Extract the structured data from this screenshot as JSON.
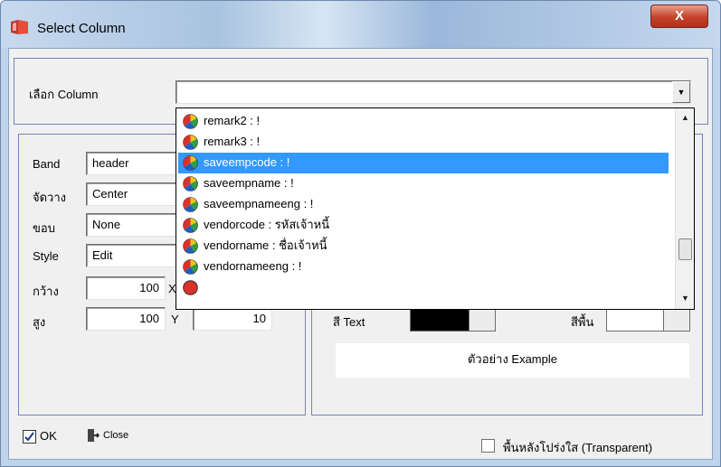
{
  "window": {
    "title": "Select Column",
    "close_label": "X"
  },
  "column_select": {
    "label": "เลือก Column",
    "value": ""
  },
  "dropdown": {
    "items": [
      {
        "label": "remark2 : !",
        "selected": false
      },
      {
        "label": "remark3 : !",
        "selected": false
      },
      {
        "label": "saveempcode : !",
        "selected": true
      },
      {
        "label": "saveempname : !",
        "selected": false
      },
      {
        "label": "saveempnameeng : !",
        "selected": false
      },
      {
        "label": "vendorcode : รหัสเจ้าหนี้",
        "selected": false
      },
      {
        "label": "vendorname : ชื่อเจ้าหนี้",
        "selected": false
      },
      {
        "label": "vendornameeng : !",
        "selected": false
      }
    ],
    "scroll_up": "▲",
    "scroll_down": "▼"
  },
  "properties": {
    "band_label": "Band",
    "band_value": "header",
    "align_label": "จัดวาง",
    "align_value": "Center",
    "border_label": "ขอบ",
    "border_value": "None",
    "style_label": "Style",
    "style_value": "Edit",
    "width_label": "กว้าง",
    "width_value": "100",
    "x_label": "X",
    "height_label": "สูง",
    "height_value": "100",
    "y_label": "Y",
    "y_value": "10"
  },
  "appearance": {
    "text_color_label": "สี Text",
    "text_color": "#000000",
    "bg_color_label": "สีพื้น",
    "bg_color": "#ffffff",
    "preview_text": "ตัวอย่าง Example"
  },
  "footer": {
    "ok_label": "OK",
    "close_label": "Close",
    "transparent_label": "พื้นหลังโปร่งใส (Transparent)",
    "transparent_checked": false
  },
  "colors": {
    "selection": "#3399ff",
    "group_border": "#7b7fc4",
    "title_close": "#c4412a"
  }
}
